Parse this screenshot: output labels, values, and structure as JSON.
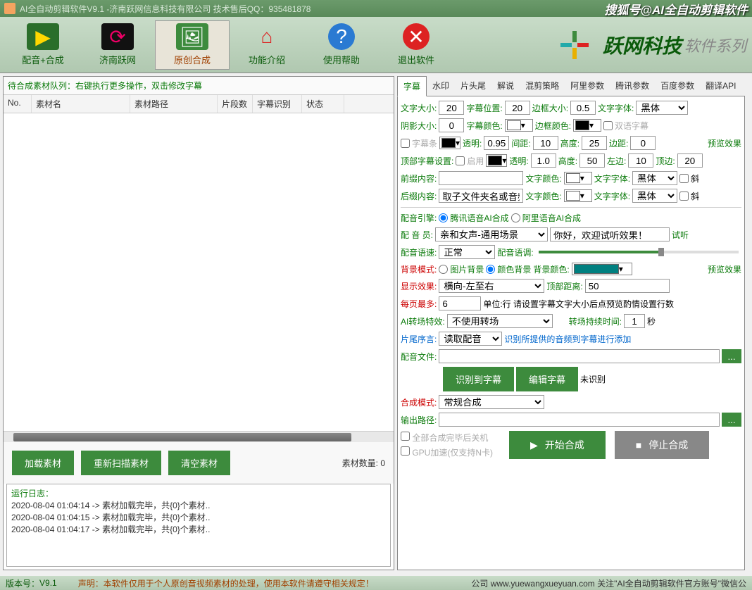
{
  "title": "AI全自动剪辑软件V9.1 -济南跃网信息科技有限公司 技术售后QQ：935481878",
  "title_right": "搜狐号@AI全自动剪辑软件",
  "toolbar": {
    "items": [
      {
        "label": "配音+合成",
        "icon": "▶"
      },
      {
        "label": "济南跃网",
        "icon": "⟳"
      },
      {
        "label": "原创合成",
        "icon": "🖼"
      },
      {
        "label": "功能介绍",
        "icon": "⌂"
      },
      {
        "label": "使用帮助",
        "icon": "?"
      },
      {
        "label": "退出软件",
        "icon": "✕"
      }
    ],
    "brand": "跃网科技",
    "brand_sub": "软件系列"
  },
  "queue_hint": "待合成素材队列：右键执行更多操作，双击修改字幕",
  "columns": {
    "no": "No.",
    "name": "素材名",
    "path": "素材路径",
    "seg": "片段数",
    "sub": "字幕识别",
    "stat": "状态"
  },
  "left_buttons": {
    "load": "加载素材",
    "rescan": "重新扫描素材",
    "clear": "清空素材"
  },
  "mat_count_label": "素材数量:",
  "mat_count": "0",
  "log": {
    "title": "运行日志：",
    "lines": [
      "2020-08-04 01:04:14 -> 素材加载完毕，共{0}个素材..",
      "2020-08-04 01:04:15 -> 素材加载完毕，共{0}个素材..",
      "2020-08-04 01:04:17 -> 素材加载完毕，共{0}个素材.."
    ]
  },
  "tabs": [
    "字幕",
    "水印",
    "片头尾",
    "解说",
    "混剪策略",
    "阿里参数",
    "腾讯参数",
    "百度参数",
    "翻译API"
  ],
  "subs": {
    "font_size_l": "文字大小:",
    "font_size": "20",
    "pos_l": "字幕位置:",
    "pos": "20",
    "border_l": "边框大小:",
    "border": "0.5",
    "font_l": "文字字体:",
    "font": "黑体",
    "shadow_l": "阴影大小:",
    "shadow": "0",
    "color_l": "字幕颜色:",
    "bcolor_l": "边框颜色:",
    "bilingual_l": "双语字幕",
    "bar_l": "字幕条",
    "alpha_bar_l": "透明:",
    "alpha_bar": "0.95",
    "gap_bar_l": "间距:",
    "gap_bar": "10",
    "h_bar_l": "高度:",
    "h_bar": "25",
    "margin_bar_l": "边距:",
    "margin_bar": "0",
    "preview": "预览效果",
    "top_l": "顶部字幕设置:",
    "enable_l": "启用",
    "alpha_top_l": "透明:",
    "alpha_top": "1.0",
    "h_top_l": "高度:",
    "h_top": "50",
    "left_top_l": "左边:",
    "left_top": "10",
    "top_top_l": "顶边:",
    "top_top": "20",
    "prefix_l": "前缀内容:",
    "prefix": "",
    "pcolor_l": "文字颜色:",
    "pfont_l": "文字字体:",
    "pfont": "黑体",
    "pitalic_l": "斜",
    "suffix_l": "后缀内容:",
    "suffix": "取子文件夹名或音频",
    "scolor_l": "文字颜色:",
    "sfont_l": "文字字体:",
    "sfont": "黑体",
    "sitalic_l": "斜"
  },
  "voice": {
    "engine_l": "配音引擎:",
    "opt1": "腾讯语音AI合成",
    "opt2": "阿里语音AI合成",
    "voice_l": "配 音 员:",
    "voice_sel": "亲和女声-通用场景",
    "sample": "你好，欢迎试听效果！",
    "try_l": "试听",
    "speed_l": "配音语速:",
    "speed": "正常",
    "tone_l": "配音语调:"
  },
  "bg": {
    "mode_l": "背景模式:",
    "opt1": "图片背景",
    "opt2": "颜色背景",
    "color_l": "背景颜色:",
    "preview": "预览效果",
    "effect_l": "显示效果:",
    "effect": "横向-左至右",
    "top_l": "顶部距离:",
    "top_v": "50",
    "max_l": "每页最多:",
    "max_v": "6",
    "max_hint": "单位:行 请设置字幕文字大小后点预览酌情设置行数",
    "trans_l": "AI转场特效:",
    "trans": "不使用转场",
    "dur_l": "转场持续时间:",
    "dur": "1",
    "sec": "秒",
    "tail_l": "片尾序言:",
    "tail": "读取配音",
    "tail_hint": "识别所提供的音频到字幕进行添加",
    "file_l": "配音文件:",
    "btn_recog": "识别到字幕",
    "btn_edit": "编辑字幕",
    "unrecog": "未识别",
    "mode2_l": "合成模式:",
    "mode2": "常规合成",
    "out_l": "输出路径:"
  },
  "checks": {
    "shutdown": "全部合成完毕后关机",
    "gpu": "GPU加速(仅支持N卡)"
  },
  "start": "开始合成",
  "stop": "停止合成",
  "footer": {
    "ver_l": "版本号：",
    "ver": "V9.1",
    "declare": "声明：本软件仅用于个人原创音视频素材的处理，使用本软件请遵守相关规定！",
    "company": "公司 www.yuewangxueyuan.com 关注\"AI全自动剪辑软件官方账号\"微信公"
  }
}
